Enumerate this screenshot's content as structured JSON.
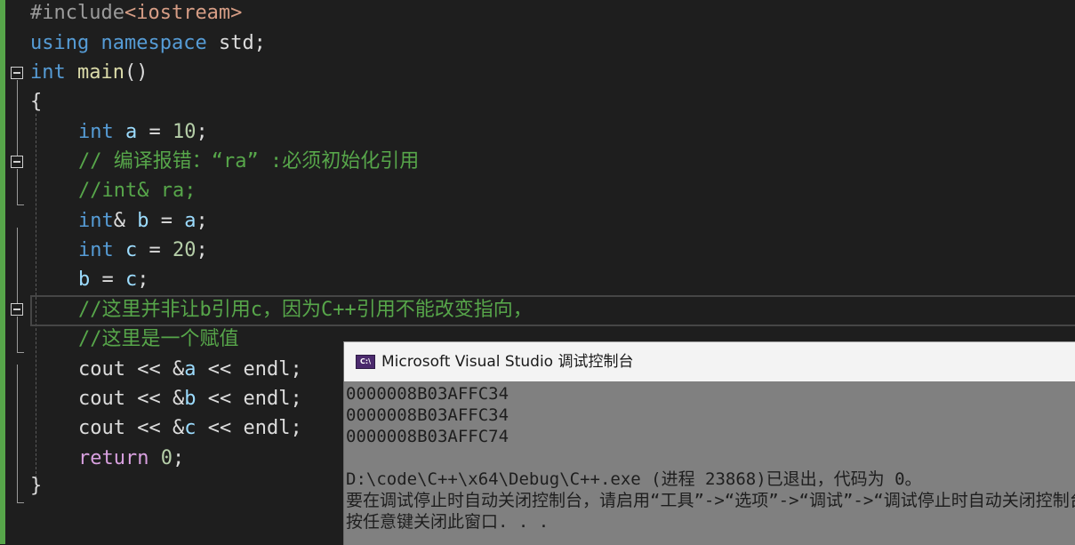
{
  "editor": {
    "lines": [
      [
        "#include",
        "<iostream>"
      ],
      [
        "using",
        " ",
        "namespace",
        " std;"
      ],
      [
        "int",
        " ",
        "main",
        "()"
      ],
      [
        "{"
      ],
      [
        "int",
        " ",
        "a",
        " = ",
        "10",
        ";"
      ],
      [
        "// 编译报错：“ra” :必须初始化引用"
      ],
      [
        "//int& ra;"
      ],
      [
        "int",
        "& ",
        "b",
        " = ",
        "a",
        ";"
      ],
      [
        "int",
        " ",
        "c",
        " = ",
        "20",
        ";"
      ],
      [
        "b",
        " = ",
        "c",
        ";"
      ],
      [
        "//这里并非让b引用c，因为C++引用不能改变指向，"
      ],
      [
        "//这里是一个赋值"
      ],
      [
        "cout",
        " << &",
        "a",
        " << ",
        "endl",
        ";"
      ],
      [
        "cout",
        " << &",
        "b",
        " << ",
        "endl",
        ";"
      ],
      [
        "cout",
        " << &",
        "c",
        " << ",
        "endl",
        ";"
      ],
      [
        "return",
        " ",
        "0",
        ";"
      ],
      [
        "}"
      ]
    ]
  },
  "console": {
    "icon_text": "C:\\",
    "title": "Microsoft Visual Studio 调试控制台",
    "output": [
      "0000008B03AFFC34",
      "0000008B03AFFC34",
      "0000008B03AFFC74",
      "",
      "D:\\code\\C++\\x64\\Debug\\C++.exe (进程 23868)已退出，代码为 0。",
      "要在调试停止时自动关闭控制台，请启用“工具”->“选项”->“调试”->“调试停止时自动关闭控制台”。",
      "按任意键关闭此窗口. . ."
    ]
  },
  "colors": {
    "background": "#1e1e1e",
    "keyword": "#569cd6",
    "comment": "#57a64a",
    "variable": "#9cdcfe",
    "number": "#b5cea8",
    "function": "#dcdcaa",
    "console_bg": "#808080"
  }
}
